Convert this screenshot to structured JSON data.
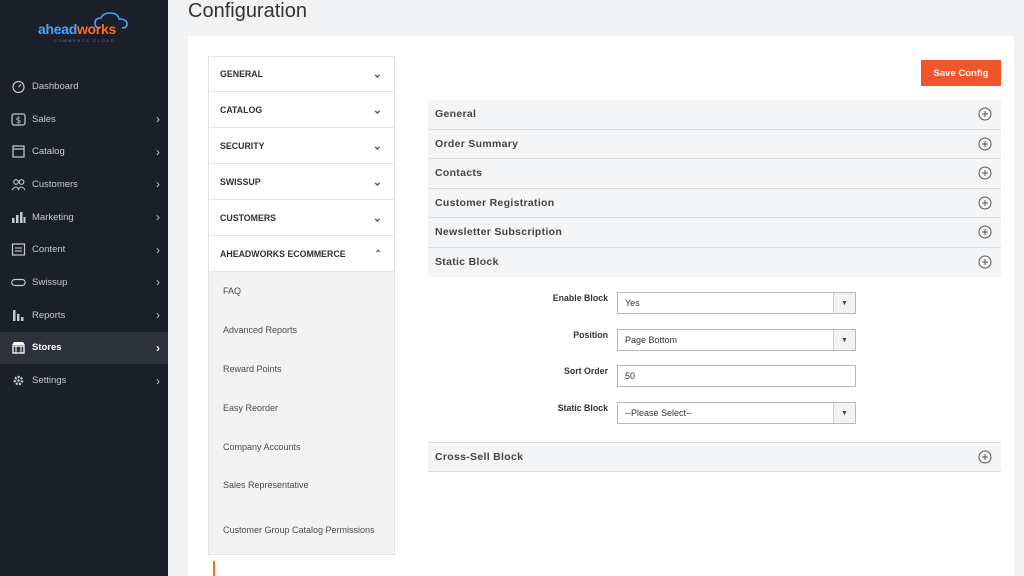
{
  "logo": {
    "part1": "ahead",
    "part2": "works",
    "tagline": "COMMERCE CLOUD"
  },
  "sidebar": {
    "items": [
      {
        "label": "Dashboard",
        "icon": "dashboard-icon",
        "chevron": false,
        "active": false
      },
      {
        "label": "Sales",
        "icon": "dollar-icon",
        "chevron": true,
        "active": false
      },
      {
        "label": "Catalog",
        "icon": "catalog-icon",
        "chevron": true,
        "active": false
      },
      {
        "label": "Customers",
        "icon": "customers-icon",
        "chevron": true,
        "active": false
      },
      {
        "label": "Marketing",
        "icon": "marketing-icon",
        "chevron": true,
        "active": false
      },
      {
        "label": "Content",
        "icon": "content-icon",
        "chevron": true,
        "active": false
      },
      {
        "label": "Swissup",
        "icon": "swissup-icon",
        "chevron": true,
        "active": false
      },
      {
        "label": "Reports",
        "icon": "reports-icon",
        "chevron": true,
        "active": false
      },
      {
        "label": "Stores",
        "icon": "stores-icon",
        "chevron": true,
        "active": true
      },
      {
        "label": "Settings",
        "icon": "gear-icon",
        "chevron": true,
        "active": false
      }
    ]
  },
  "page": {
    "title": "Configuration"
  },
  "tabs": [
    {
      "label": "GENERAL",
      "expanded": false
    },
    {
      "label": "CATALOG",
      "expanded": false
    },
    {
      "label": "SECURITY",
      "expanded": false
    },
    {
      "label": "SWISSUP",
      "expanded": false
    },
    {
      "label": "CUSTOMERS",
      "expanded": false
    },
    {
      "label": "AHEADWORKS ECOMMERCE",
      "expanded": true
    }
  ],
  "subtabs": [
    "FAQ",
    "Advanced Reports",
    "Reward Points",
    "Easy Reorder",
    "Company Accounts",
    "Sales Representative",
    "Customer Group Catalog Permissions"
  ],
  "toolbar": {
    "save_label": "Save Config"
  },
  "sections": [
    "General",
    "Order Summary",
    "Contacts",
    "Customer Registration",
    "Newsletter Subscription",
    "Static Block"
  ],
  "form": {
    "enable_block": {
      "label": "Enable Block",
      "value": "Yes"
    },
    "position": {
      "label": "Position",
      "value": "Page Bottom"
    },
    "sort_order": {
      "label": "Sort Order",
      "value": "50"
    },
    "static_block": {
      "label": "Static Block",
      "value": "--Please Select--"
    }
  },
  "last_section": "Cross-Sell Block",
  "colors": {
    "accent": "#f0562b",
    "sidebar": "#1b1f2a",
    "logo_blue": "#4aa3ff",
    "logo_orange": "#ff6a2b"
  }
}
